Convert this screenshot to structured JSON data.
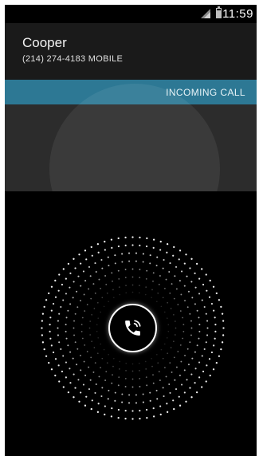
{
  "status_bar": {
    "time": "11:59",
    "signal_icon": "signal-icon",
    "battery_icon": "battery-icon",
    "battery_level": 0.85
  },
  "contact": {
    "name": "Cooper",
    "number_line": "(214) 274-4183  MOBILE"
  },
  "call_state": {
    "label": "INCOMING CALL",
    "accent_color": "#2d7894"
  },
  "answer_control": {
    "icon": "phone-handset-icon"
  }
}
